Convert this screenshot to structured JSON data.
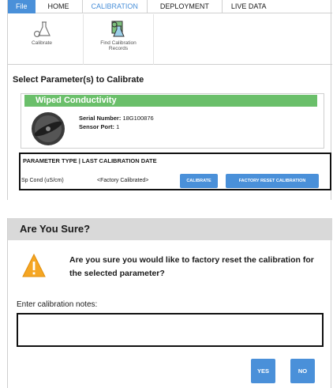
{
  "tabs": [
    {
      "label": "File"
    },
    {
      "label": "HOME"
    },
    {
      "label": "CALIBRATION"
    },
    {
      "label": "DEPLOYMENT"
    },
    {
      "label": "LIVE DATA"
    }
  ],
  "ribbon": {
    "calibrate_label": "Calibrate",
    "find_label_line1": "Find Calibration",
    "find_label_line2": "Records"
  },
  "section_title": "Select Parameter(s) to Calibrate",
  "sensor": {
    "name": "Wiped Conductivity",
    "serial_label": "Serial Number:",
    "serial_value": "18G100876",
    "port_label": "Sensor Port:",
    "port_value": "1"
  },
  "parameters": {
    "header": "PARAMETER TYPE | LAST CALIBRATION DATE",
    "rows": [
      {
        "name": "Sp Cond (uS/cm)",
        "last_calibration": "<Factory Calibrated>",
        "calibrate_label": "CALIBRATE",
        "reset_label": "FACTORY RESET CALIBRATION"
      }
    ]
  },
  "dialog": {
    "title": "Are You Sure?",
    "message": "Are you sure you would like to factory reset the calibration for the selected parameter?",
    "notes_label": "Enter calibration notes:",
    "notes_value": "",
    "yes_label": "YES",
    "no_label": "NO"
  },
  "colors": {
    "accent_blue": "#4a90d9",
    "sensor_header_green": "#6abf6a",
    "dialog_header_gray": "#d9d9d9",
    "warning_orange": "#f5a623"
  },
  "icons": {
    "calibrate": "flask-icon",
    "find_records": "flask-search-icon",
    "probe": "sensor-probe-icon",
    "warning": "warning-triangle-icon"
  }
}
